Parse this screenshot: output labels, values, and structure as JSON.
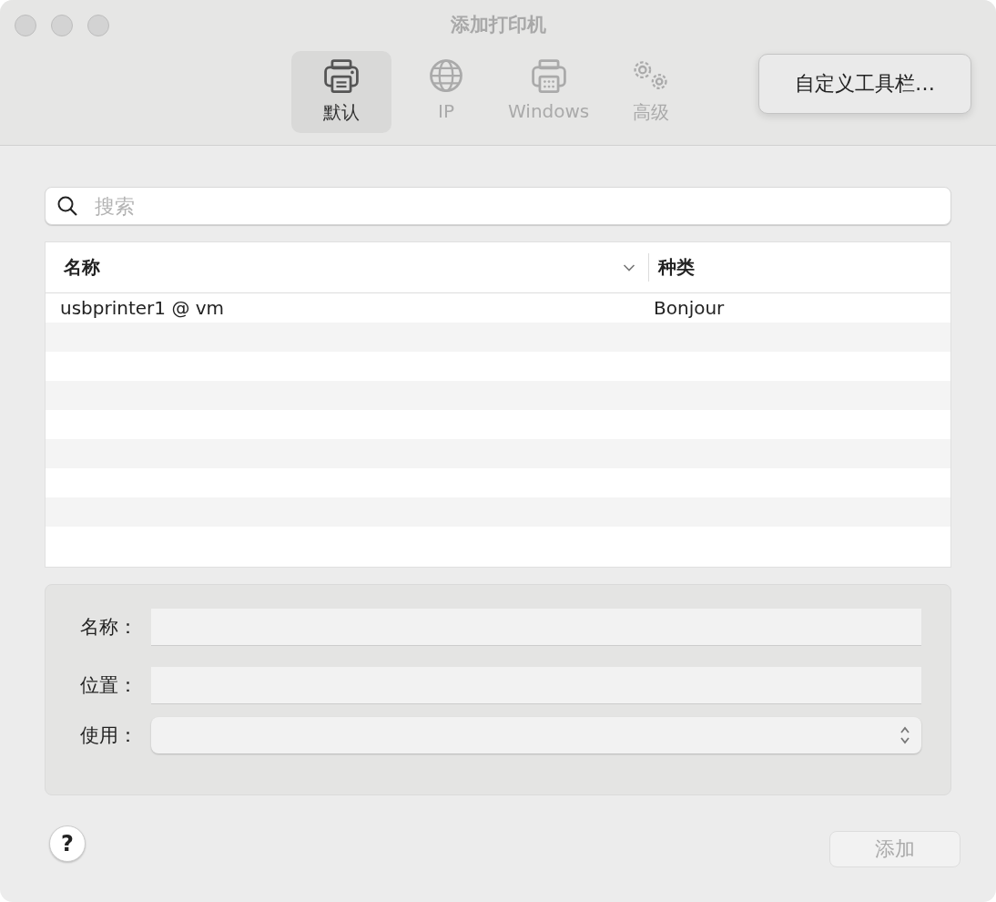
{
  "window": {
    "title": "添加打印机"
  },
  "toolbar": {
    "tabs": [
      {
        "label": "默认",
        "kind": "printer",
        "selected": true
      },
      {
        "label": "IP",
        "kind": "globe",
        "selected": false
      },
      {
        "label": "Windows",
        "kind": "fax",
        "selected": false
      },
      {
        "label": "高级",
        "kind": "gears",
        "selected": false
      }
    ],
    "customize_button": "自定义工具栏…"
  },
  "search": {
    "placeholder": "搜索"
  },
  "table": {
    "columns": [
      {
        "label": "名称",
        "sorted": true
      },
      {
        "label": "种类",
        "sorted": false
      }
    ],
    "rows": [
      {
        "cells": [
          "usbprinter1 @ vm",
          "Bonjour"
        ]
      }
    ]
  },
  "form": {
    "fields": [
      {
        "label": "名称：",
        "kind": "text"
      },
      {
        "label": "位置：",
        "kind": "text"
      },
      {
        "label": "使用：",
        "kind": "select"
      }
    ]
  },
  "help_button": "?",
  "add_button": {
    "label": "添加",
    "disabled": true
  }
}
